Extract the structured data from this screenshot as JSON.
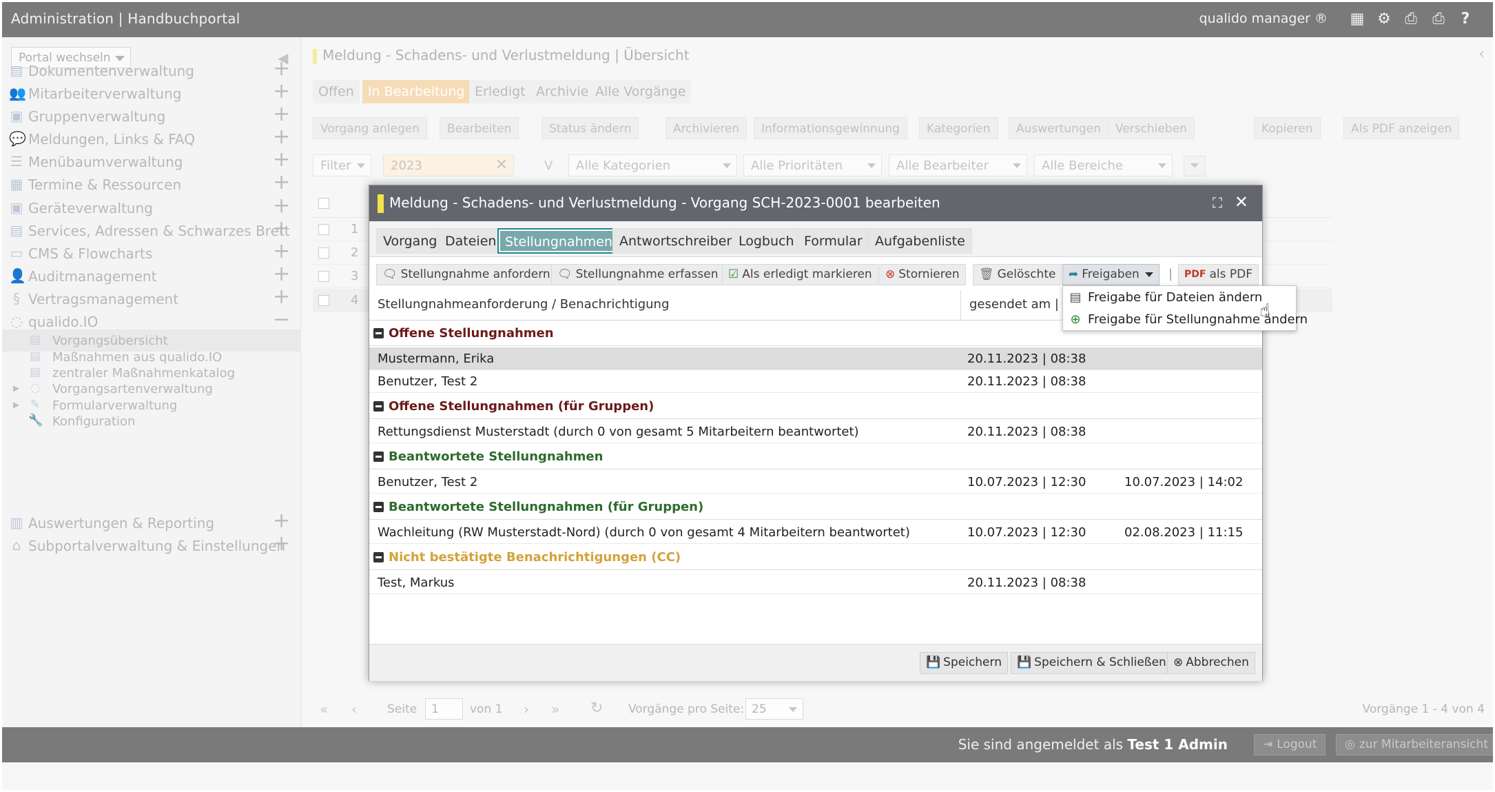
{
  "app": {
    "title": "Administration | Handbuchportal",
    "brand": "qualido manager ®"
  },
  "sidebar": {
    "portal_select": "Portal wechseln",
    "items": [
      {
        "label": "Dokumentenverwaltung",
        "icon": "document-icon"
      },
      {
        "label": "Mitarbeiterverwaltung",
        "icon": "users-icon"
      },
      {
        "label": "Gruppenverwaltung",
        "icon": "group-icon"
      },
      {
        "label": "Meldungen, Links & FAQ",
        "icon": "chat-icon"
      },
      {
        "label": "Menübaumverwaltung",
        "icon": "list-icon"
      },
      {
        "label": "Termine & Ressourcen",
        "icon": "calendar-icon"
      },
      {
        "label": "Geräteverwaltung",
        "icon": "device-icon"
      },
      {
        "label": "Services, Adressen & Schwarzes Brett",
        "icon": "address-card-icon"
      },
      {
        "label": "CMS & Flowcharts",
        "icon": "monitor-icon"
      },
      {
        "label": "Auditmanagement",
        "icon": "person-icon"
      },
      {
        "label": "Vertragsmanagement",
        "icon": "paragraph-icon"
      },
      {
        "label": "qualido.IO",
        "icon": "qualido-icon"
      }
    ],
    "sub_items": [
      {
        "label": "Vorgangsübersicht"
      },
      {
        "label": "Maßnahmen aus qualido.IO"
      },
      {
        "label": "zentraler Maßnahmenkatalog"
      },
      {
        "label": "Vorgangsartenverwaltung"
      },
      {
        "label": "Formularverwaltung"
      },
      {
        "label": "Konfiguration"
      }
    ],
    "bottom_items": [
      {
        "label": "Auswertungen & Reporting",
        "icon": "chart-icon"
      },
      {
        "label": "Subportalverwaltung & Einstellungen",
        "icon": "home-icon"
      }
    ]
  },
  "main": {
    "title": "Meldung - Schadens- und Verlustmeldung | Übersicht",
    "status_tabs": [
      "Offen",
      "In Bearbeitung",
      "Erledigt",
      "Archiviert",
      "Alle Vorgänge"
    ],
    "toolbar": [
      "Vorgang anlegen",
      "Bearbeiten",
      "Status ändern",
      "Archivieren",
      "Informationsgewinnung",
      "Kategorien",
      "Auswertungen",
      "Verschieben",
      "Kopieren",
      "Als PDF anzeigen"
    ],
    "filter": {
      "filter_label": "Filter",
      "search_value": "2023",
      "kategorien": "Alle Kategorien",
      "prioritaeten": "Alle Prioritäten",
      "bearbeiter": "Alle Bearbeiter",
      "bereiche": "Alle Bereiche"
    },
    "row_numbers": [
      "1",
      "2",
      "3",
      "4"
    ]
  },
  "pager": {
    "seite": "Seite",
    "page_value": "1",
    "von": "von 1",
    "per_page_label": "Vorgänge pro Seite:",
    "per_page_value": "25",
    "summary": "Vorgänge 1 - 4 von 4"
  },
  "footer": {
    "login_text": "Sie sind angemeldet als",
    "login_user": "Test 1 Admin",
    "logout": "Logout",
    "employee_view": "zur Mitarbeiteransicht"
  },
  "modal": {
    "title": "Meldung - Schadens- und Verlustmeldung - Vorgang SCH-2023-0001 bearbeiten",
    "tabs": [
      "Vorgang",
      "Dateien",
      "Stellungnahmen",
      "Antwortschreiben",
      "Logbuch",
      "Formular",
      "Aufgabenliste"
    ],
    "toolbar": {
      "anfordern": "Stellungnahme anfordern",
      "erfassen": "Stellungnahme erfassen",
      "erledigt": "Als erledigt markieren",
      "stornieren": "Stornieren",
      "geloeschte": "Gelöschte",
      "freigaben": "Freigaben",
      "pdf": "als PDF"
    },
    "table": {
      "col1": "Stellungnahmeanforderung / Benachrichtigung",
      "col2": "gesendet am |",
      "groups": [
        {
          "label": "Offene Stellungnahmen",
          "color": "#6b1a1a",
          "rows": [
            {
              "name": "Mustermann, Erika",
              "sent": "20.11.2023 | 08:38",
              "answered": ""
            },
            {
              "name": "Benutzer, Test 2",
              "sent": "20.11.2023 | 08:38",
              "answered": ""
            }
          ]
        },
        {
          "label": "Offene Stellungnahmen (für Gruppen)",
          "color": "#6b1a1a",
          "rows": [
            {
              "name": "Rettungsdienst Musterstadt (durch 0 von gesamt 5 Mitarbeitern beantwortet)",
              "sent": "20.11.2023 | 08:38",
              "answered": ""
            }
          ]
        },
        {
          "label": "Beantwortete Stellungnahmen",
          "color": "#2e6b2e",
          "rows": [
            {
              "name": "Benutzer, Test 2",
              "sent": "10.07.2023 | 12:30",
              "answered": "10.07.2023 | 14:02"
            }
          ]
        },
        {
          "label": "Beantwortete Stellungnahmen (für Gruppen)",
          "color": "#2e6b2e",
          "rows": [
            {
              "name": "Wachleitung (RW Musterstadt-Nord) (durch 0 von gesamt 4 Mitarbeitern beantwortet)",
              "sent": "10.07.2023 | 12:30",
              "answered": "02.08.2023 | 11:15"
            }
          ]
        },
        {
          "label": "Nicht bestätigte Benachrichtigungen (CC)",
          "color": "#d4a23a",
          "rows": [
            {
              "name": "Test, Markus",
              "sent": "20.11.2023 | 08:38",
              "answered": ""
            }
          ]
        }
      ]
    },
    "footer": {
      "save": "Speichern",
      "save_close": "Speichern & Schließen",
      "cancel": "Abbrechen"
    }
  },
  "dropdown": {
    "items": [
      {
        "label": "Freigabe für Dateien ändern",
        "icon": "document-icon"
      },
      {
        "label": "Freigabe für Stellungnahme ändern",
        "icon": "plus-circle-icon"
      }
    ]
  }
}
